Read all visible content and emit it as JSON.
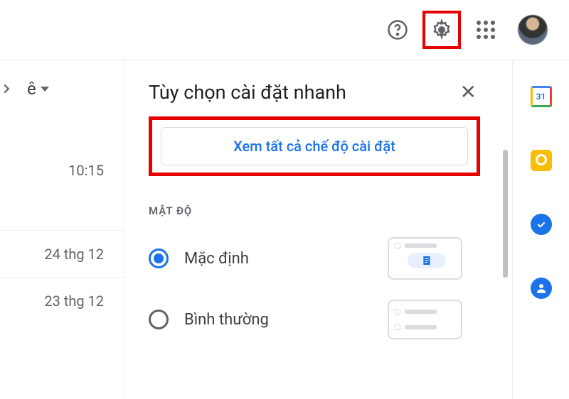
{
  "header": {
    "help_icon": "help-icon",
    "settings_icon": "gear-icon",
    "apps_icon": "apps-grid-icon"
  },
  "left": {
    "language_label": "ê",
    "times": [
      "10:15",
      "24 thg 12",
      "23 thg 12"
    ]
  },
  "panel": {
    "title": "Tùy chọn cài đặt nhanh",
    "all_settings_label": "Xem tất cả chế độ cài đặt",
    "density_section": "MẬT ĐỘ",
    "density_options": [
      {
        "label": "Mặc định",
        "checked": true
      },
      {
        "label": "Bình thường",
        "checked": false
      }
    ]
  },
  "sidebar": {
    "calendar_day": "31"
  }
}
